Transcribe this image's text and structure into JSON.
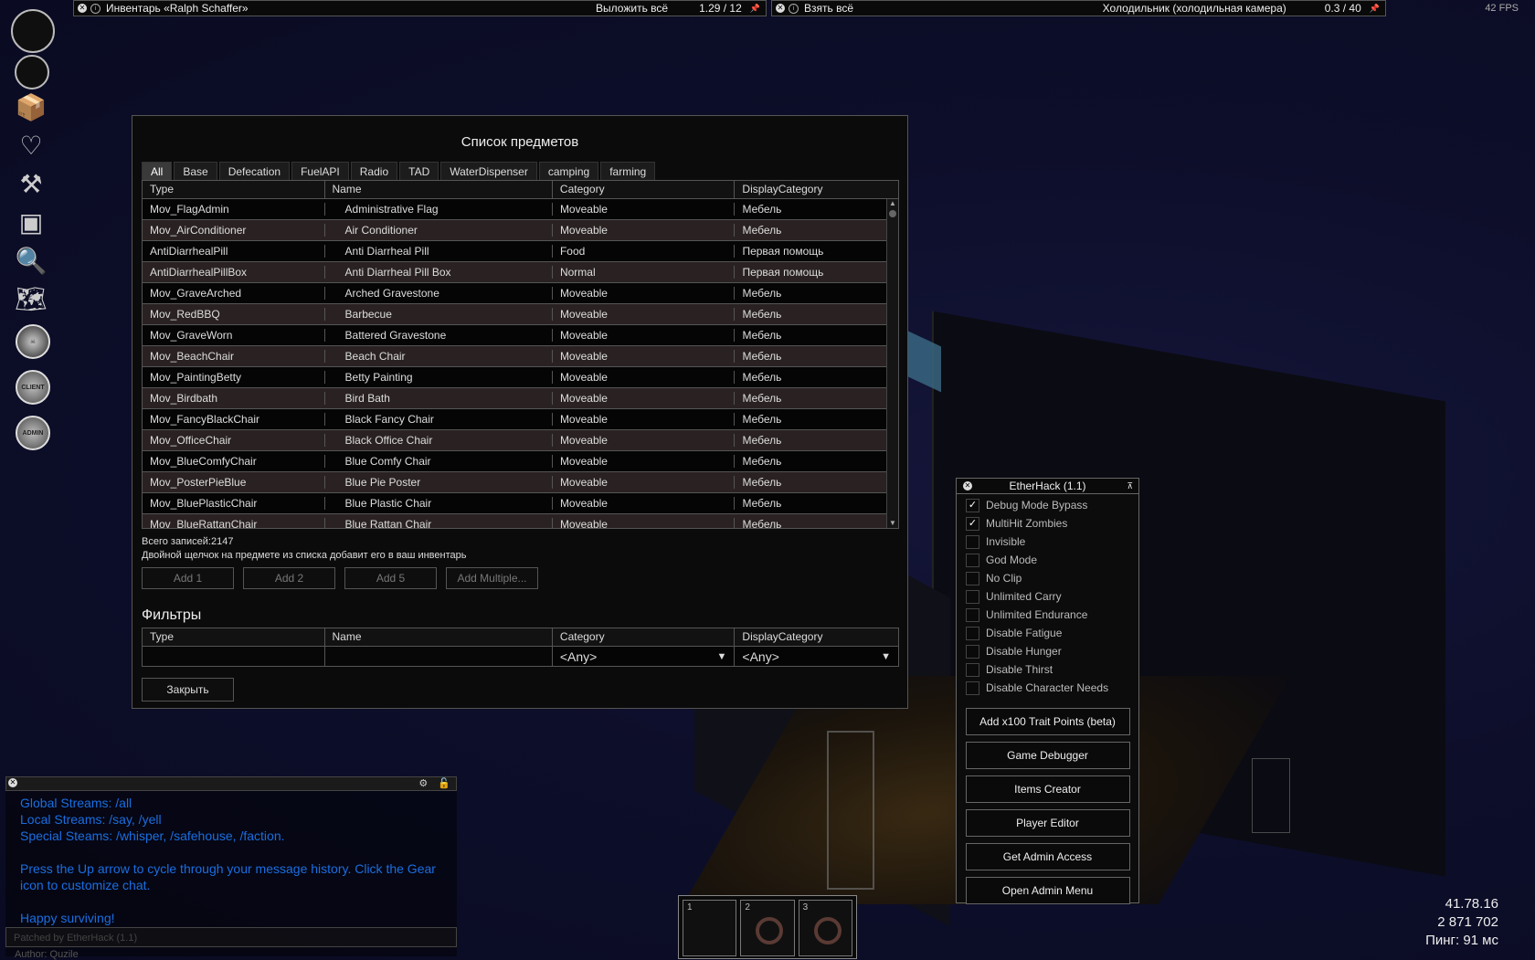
{
  "topbar_left": {
    "title": "Инвентарь «Ralph Schaffer»",
    "action": "Выложить всё",
    "weight": "1.29 / 12"
  },
  "topbar_right": {
    "action": "Взять всё",
    "container": "Холодильник (холодильная камера)",
    "weight": "0.3 / 40"
  },
  "fps": "42 FPS",
  "sidebar": {
    "icons": [
      "circle-icon",
      "circle-icon",
      "crafting-box-icon",
      "health-heart-icon",
      "hammer-tools-icon",
      "furniture-icon",
      "search-magnifier-icon",
      "map-icon",
      "zombie-head-icon",
      "client-icon",
      "admin-icon"
    ],
    "client_label": "CLIENT",
    "admin_label": "ADMIN"
  },
  "items_window": {
    "title": "Список предметов",
    "tabs": [
      "All",
      "Base",
      "Defecation",
      "FuelAPI",
      "Radio",
      "TAD",
      "WaterDispenser",
      "camping",
      "farming"
    ],
    "columns": [
      "Type",
      "Name",
      "Category",
      "DisplayCategory"
    ],
    "rows": [
      [
        "Mov_FlagAdmin",
        "Administrative Flag",
        "Moveable",
        "Мебель"
      ],
      [
        "Mov_AirConditioner",
        "Air Conditioner",
        "Moveable",
        "Мебель"
      ],
      [
        "AntiDiarrhealPill",
        "Anti Diarrheal Pill",
        "Food",
        "Первая помощь"
      ],
      [
        "AntiDiarrhealPillBox",
        "Anti Diarrheal Pill Box",
        "Normal",
        "Первая помощь"
      ],
      [
        "Mov_GraveArched",
        "Arched Gravestone",
        "Moveable",
        "Мебель"
      ],
      [
        "Mov_RedBBQ",
        "Barbecue",
        "Moveable",
        "Мебель"
      ],
      [
        "Mov_GraveWorn",
        "Battered Gravestone",
        "Moveable",
        "Мебель"
      ],
      [
        "Mov_BeachChair",
        "Beach Chair",
        "Moveable",
        "Мебель"
      ],
      [
        "Mov_PaintingBetty",
        "Betty Painting",
        "Moveable",
        "Мебель"
      ],
      [
        "Mov_Birdbath",
        "Bird Bath",
        "Moveable",
        "Мебель"
      ],
      [
        "Mov_FancyBlackChair",
        "Black Fancy Chair",
        "Moveable",
        "Мебель"
      ],
      [
        "Mov_OfficeChair",
        "Black Office Chair",
        "Moveable",
        "Мебель"
      ],
      [
        "Mov_BlueComfyChair",
        "Blue Comfy Chair",
        "Moveable",
        "Мебель"
      ],
      [
        "Mov_PosterPieBlue",
        "Blue Pie Poster",
        "Moveable",
        "Мебель"
      ],
      [
        "Mov_BluePlasticChair",
        "Blue Plastic Chair",
        "Moveable",
        "Мебель"
      ],
      [
        "Mov_BlueRattanChair",
        "Blue Rattan Chair",
        "Moveable",
        "Мебель"
      ]
    ],
    "total": "Всего записей:2147",
    "hint": "Двойной щелчок на предмете из списка добавит его в ваш инвентарь",
    "buttons": [
      "Add 1",
      "Add 2",
      "Add 5",
      "Add Multiple..."
    ],
    "filters_title": "Фильтры",
    "filter_columns": [
      "Type",
      "Name",
      "Category",
      "DisplayCategory"
    ],
    "filter_category_value": "<Any>",
    "filter_display_value": "<Any>",
    "close_label": "Закрыть"
  },
  "etherhack": {
    "title": "EtherHack (1.1)",
    "options": [
      {
        "label": "Debug Mode Bypass",
        "checked": true
      },
      {
        "label": "MultiHit Zombies",
        "checked": true
      },
      {
        "label": "Invisible",
        "checked": false
      },
      {
        "label": "God Mode",
        "checked": false
      },
      {
        "label": "No Clip",
        "checked": false
      },
      {
        "label": "Unlimited Carry",
        "checked": false
      },
      {
        "label": "Unlimited Endurance",
        "checked": false
      },
      {
        "label": "Disable Fatigue",
        "checked": false
      },
      {
        "label": "Disable Hunger",
        "checked": false
      },
      {
        "label": "Disable Thirst",
        "checked": false
      },
      {
        "label": "Disable Character Needs",
        "checked": false
      }
    ],
    "buttons": [
      "Add x100 Trait Points (beta)",
      "Game Debugger",
      "Items Creator",
      "Player Editor",
      "Get Admin Access",
      "Open Admin Menu"
    ]
  },
  "chat": {
    "lines": [
      "Global Streams: /all",
      "Local Streams: /say, /yell",
      "Special Steams: /whisper, /safehouse, /faction.",
      "",
      "Press the Up arrow to cycle through your message history. Click the Gear icon to customize chat.",
      "",
      "Happy surviving!"
    ],
    "input_text": "Patched by EtherHack (1.1)",
    "author": "Author: Quzile"
  },
  "hotbar": {
    "slots": [
      "1",
      "2",
      "3"
    ]
  },
  "stats": {
    "version": "41.78.16",
    "money": "2 871 702",
    "ping": "Пинг: 91 мс"
  },
  "colors": {
    "chat_text": "#1a6ee0",
    "panel_bg": "#0b0b0b",
    "border": "#555555"
  }
}
